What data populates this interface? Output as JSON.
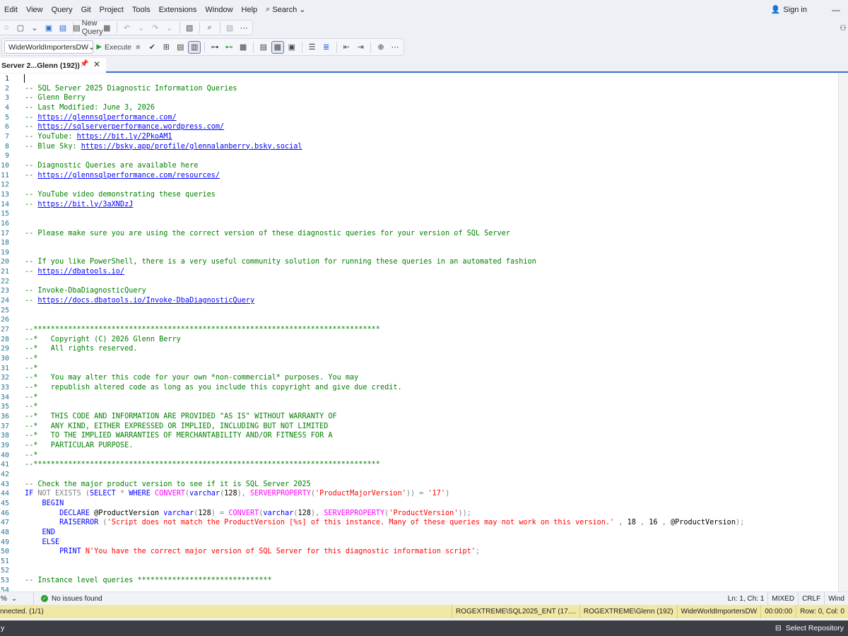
{
  "menu": {
    "items": [
      "Edit",
      "View",
      "Query",
      "Git",
      "Project",
      "Tools",
      "Extensions",
      "Window",
      "Help"
    ],
    "search_label": "Search",
    "sign_in": "Sign in",
    "minimize": "—"
  },
  "toolbar": {
    "new_query": "New Query",
    "database": "WideWorldImportersDW",
    "execute": "Execute"
  },
  "tab": {
    "title": "Server 2...Glenn (192))"
  },
  "editor": {
    "current_line": 1,
    "lines": [
      [],
      [
        [
          "c",
          "-- SQL Server 2025 Diagnostic Information Queries"
        ]
      ],
      [
        [
          "c",
          "-- Glenn Berry"
        ]
      ],
      [
        [
          "c",
          "-- Last Modified: June 3, 2026"
        ]
      ],
      [
        [
          "c",
          "-- "
        ],
        [
          "l",
          "https://glennsqlperformance.com/"
        ]
      ],
      [
        [
          "c",
          "-- "
        ],
        [
          "l",
          "https://sqlserverperformance.wordpress.com/"
        ]
      ],
      [
        [
          "c",
          "-- YouTube: "
        ],
        [
          "l",
          "https://bit.ly/2PkoAM1"
        ]
      ],
      [
        [
          "c",
          "-- Blue Sky: "
        ],
        [
          "l",
          "https://bsky.app/profile/glennalanberry.bsky.social"
        ]
      ],
      [],
      [
        [
          "c",
          "-- Diagnostic Queries are available here"
        ]
      ],
      [
        [
          "c",
          "-- "
        ],
        [
          "l",
          "https://glennsqlperformance.com/resources/"
        ]
      ],
      [],
      [
        [
          "c",
          "-- YouTube video demonstrating these queries"
        ]
      ],
      [
        [
          "c",
          "-- "
        ],
        [
          "l",
          "https://bit.ly/3aXNDzJ"
        ]
      ],
      [],
      [],
      [
        [
          "c",
          "-- Please make sure you are using the correct version of these diagnostic queries for your version of SQL Server"
        ]
      ],
      [],
      [],
      [
        [
          "c",
          "-- If you like PowerShell, there is a very useful community solution for running these queries in an automated fashion"
        ]
      ],
      [
        [
          "c",
          "-- "
        ],
        [
          "l",
          "https://dbatools.io/"
        ]
      ],
      [],
      [
        [
          "c",
          "-- Invoke-DbaDiagnosticQuery"
        ]
      ],
      [
        [
          "c",
          "-- "
        ],
        [
          "l",
          "https://docs.dbatools.io/Invoke-DbaDiagnosticQuery"
        ]
      ],
      [],
      [],
      [
        [
          "c",
          "--********************************************************************************"
        ]
      ],
      [
        [
          "c",
          "--*   Copyright (C) 2026 Glenn Berry"
        ]
      ],
      [
        [
          "c",
          "--*   All rights reserved."
        ]
      ],
      [
        [
          "c",
          "--*"
        ]
      ],
      [
        [
          "c",
          "--*"
        ]
      ],
      [
        [
          "c",
          "--*   You may alter this code for your own *non-commercial* purposes. You may"
        ]
      ],
      [
        [
          "c",
          "--*   republish altered code as long as you include this copyright and give due credit."
        ]
      ],
      [
        [
          "c",
          "--*"
        ]
      ],
      [
        [
          "c",
          "--*"
        ]
      ],
      [
        [
          "c",
          "--*   THIS CODE AND INFORMATION ARE PROVIDED \"AS IS\" WITHOUT WARRANTY OF"
        ]
      ],
      [
        [
          "c",
          "--*   ANY KIND, EITHER EXPRESSED OR IMPLIED, INCLUDING BUT NOT LIMITED"
        ]
      ],
      [
        [
          "c",
          "--*   TO THE IMPLIED WARRANTIES OF MERCHANTABILITY AND/OR FITNESS FOR A"
        ]
      ],
      [
        [
          "c",
          "--*   PARTICULAR PURPOSE."
        ]
      ],
      [
        [
          "c",
          "--*"
        ]
      ],
      [
        [
          "c",
          "--********************************************************************************"
        ]
      ],
      [],
      [
        [
          "c",
          "-- Check the major product version to see if it is SQL Server 2025"
        ]
      ],
      [
        [
          "k",
          "IF "
        ],
        [
          "g",
          "NOT EXISTS "
        ],
        [
          "g",
          "("
        ],
        [
          "k",
          "SELECT "
        ],
        [
          "g",
          "* "
        ],
        [
          "k",
          "WHERE "
        ],
        [
          "f",
          "CONVERT"
        ],
        [
          "g",
          "("
        ],
        [
          "k",
          "varchar"
        ],
        [
          "g",
          "("
        ],
        [
          "p",
          "128"
        ],
        [
          "g",
          "), "
        ],
        [
          "f",
          "SERVERPROPERTY"
        ],
        [
          "g",
          "("
        ],
        [
          "s",
          "'ProductMajorVersion'"
        ],
        [
          "g",
          ")) = "
        ],
        [
          "s",
          "'17'"
        ],
        [
          "g",
          ")"
        ]
      ],
      [
        [
          "p",
          "    "
        ],
        [
          "k",
          "BEGIN"
        ]
      ],
      [
        [
          "p",
          "        "
        ],
        [
          "k",
          "DECLARE "
        ],
        [
          "p",
          "@ProductVersion "
        ],
        [
          "k",
          "varchar"
        ],
        [
          "g",
          "("
        ],
        [
          "p",
          "128"
        ],
        [
          "g",
          ") = "
        ],
        [
          "f",
          "CONVERT"
        ],
        [
          "g",
          "("
        ],
        [
          "k",
          "varchar"
        ],
        [
          "g",
          "("
        ],
        [
          "p",
          "128"
        ],
        [
          "g",
          "), "
        ],
        [
          "f",
          "SERVERPROPERTY"
        ],
        [
          "g",
          "("
        ],
        [
          "s",
          "'ProductVersion'"
        ],
        [
          "g",
          "));"
        ]
      ],
      [
        [
          "p",
          "        "
        ],
        [
          "k",
          "RAISERROR "
        ],
        [
          "g",
          "("
        ],
        [
          "s",
          "'Script does not match the ProductVersion [%s] of this instance. Many of these queries may not work on this version.'"
        ],
        [
          "g",
          " , "
        ],
        [
          "p",
          "18"
        ],
        [
          "g",
          " , "
        ],
        [
          "p",
          "16"
        ],
        [
          "g",
          " , "
        ],
        [
          "p",
          "@ProductVersion"
        ],
        [
          "g",
          ");"
        ]
      ],
      [
        [
          "p",
          "    "
        ],
        [
          "k",
          "END"
        ]
      ],
      [
        [
          "p",
          "    "
        ],
        [
          "k",
          "ELSE"
        ]
      ],
      [
        [
          "p",
          "        "
        ],
        [
          "k",
          "PRINT "
        ],
        [
          "s",
          "N'You have the correct major version of SQL Server for this diagnostic information script'"
        ],
        [
          "g",
          ";"
        ]
      ],
      [],
      [],
      [
        [
          "c",
          "-- Instance level queries *******************************"
        ]
      ],
      []
    ]
  },
  "infobar": {
    "zoom": "%",
    "issues": "No issues found",
    "ln_col": "Ln: 1, Ch: 1",
    "mixed": "MIXED",
    "crlf": "CRLF",
    "wind": "Wind"
  },
  "statusbar": {
    "connected": "nnected. (1/1)",
    "server": "ROGEXTREME\\SQL2025_ENT (17....",
    "user": "ROGEXTREME\\Glenn (192)",
    "db": "WideWorldImportersDW",
    "time": "00:00:00",
    "rows": "Row: 0, Col: 0"
  },
  "taskbar": {
    "select_repo": "Select Repository"
  }
}
